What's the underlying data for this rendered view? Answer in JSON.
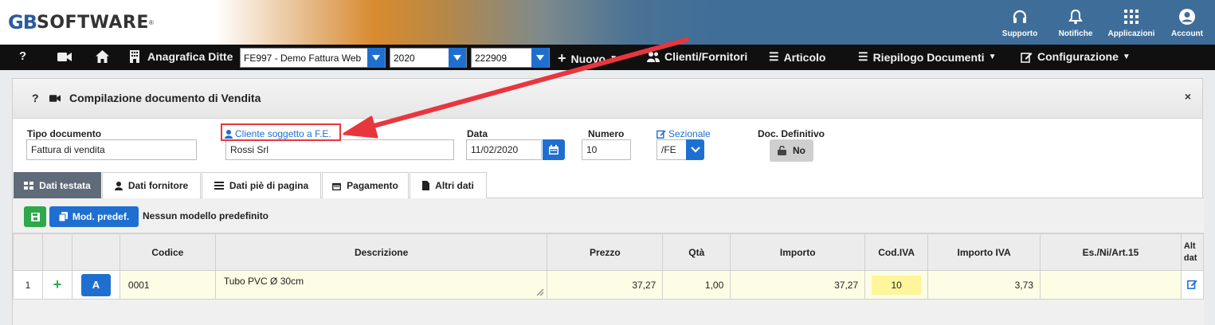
{
  "brand": {
    "logo_gb": "GB",
    "logo_rest": "SOFTWARE",
    "logo_reg": "®"
  },
  "topbar": {
    "items": [
      {
        "label": "Supporto",
        "icon": "headset-icon"
      },
      {
        "label": "Notifiche",
        "icon": "bell-icon"
      },
      {
        "label": "Applicazioni",
        "icon": "grid-icon"
      },
      {
        "label": "Account",
        "icon": "user-circle-icon"
      }
    ]
  },
  "nav": {
    "help": "?",
    "anagrafica": "Anagrafica Ditte",
    "company_select": "FE997 - Demo Fattura Web",
    "year_select": "2020",
    "code_select": "222909",
    "nuovo": "Nuovo",
    "clienti": "Clienti/Fornitori",
    "articolo": "Articolo",
    "riepilogo": "Riepilogo Documenti",
    "configurazione": "Configurazione"
  },
  "panel": {
    "help": "?",
    "title": "Compilazione documento di Vendita",
    "close": "×"
  },
  "form": {
    "tipo_label": "Tipo documento",
    "tipo_value": "Fattura di vendita",
    "cliente_label": "Cliente soggetto a F.E.",
    "cliente_value": "Rossi Srl",
    "data_label": "Data",
    "data_value": "11/02/2020",
    "numero_label": "Numero",
    "numero_value": "10",
    "sezionale_label": "Sezionale",
    "sezionale_value": "/FE",
    "definitivo_label": "Doc. Definitivo",
    "definitivo_value": "No"
  },
  "tabs": [
    {
      "label": "Dati testata",
      "icon": "table-icon",
      "active": true
    },
    {
      "label": "Dati fornitore",
      "icon": "user-icon",
      "active": false
    },
    {
      "label": "Dati piè di pagina",
      "icon": "list-icon",
      "active": false
    },
    {
      "label": "Pagamento",
      "icon": "calendar-icon",
      "active": false
    },
    {
      "label": "Altri dati",
      "icon": "file-icon",
      "active": false
    }
  ],
  "toolbar": {
    "mod_predef": "Mod. predef.",
    "no_model": "Nessun modello predefinito"
  },
  "table": {
    "columns": [
      "Codice",
      "Descrizione",
      "Prezzo",
      "Qtà",
      "Importo",
      "Cod.IVA",
      "Importo IVA",
      "Es./Ni/Art.15",
      "Alt dat"
    ],
    "rows": [
      {
        "n": "1",
        "add": "+",
        "type": "A",
        "codice": "0001",
        "descrizione": "Tubo PVC Ø 30cm",
        "prezzo": "37,27",
        "qta": "1,00",
        "importo": "37,27",
        "codiva": "10",
        "importo_iva": "3,73",
        "esenzione": ""
      }
    ]
  },
  "colors": {
    "accent_blue": "#1f6fd0",
    "green": "#2ea84a",
    "highlight_red": "#e8363f",
    "row_yellow": "#fdfde6",
    "iva_yellow": "#fff59a",
    "active_tab": "#5f6b78"
  }
}
